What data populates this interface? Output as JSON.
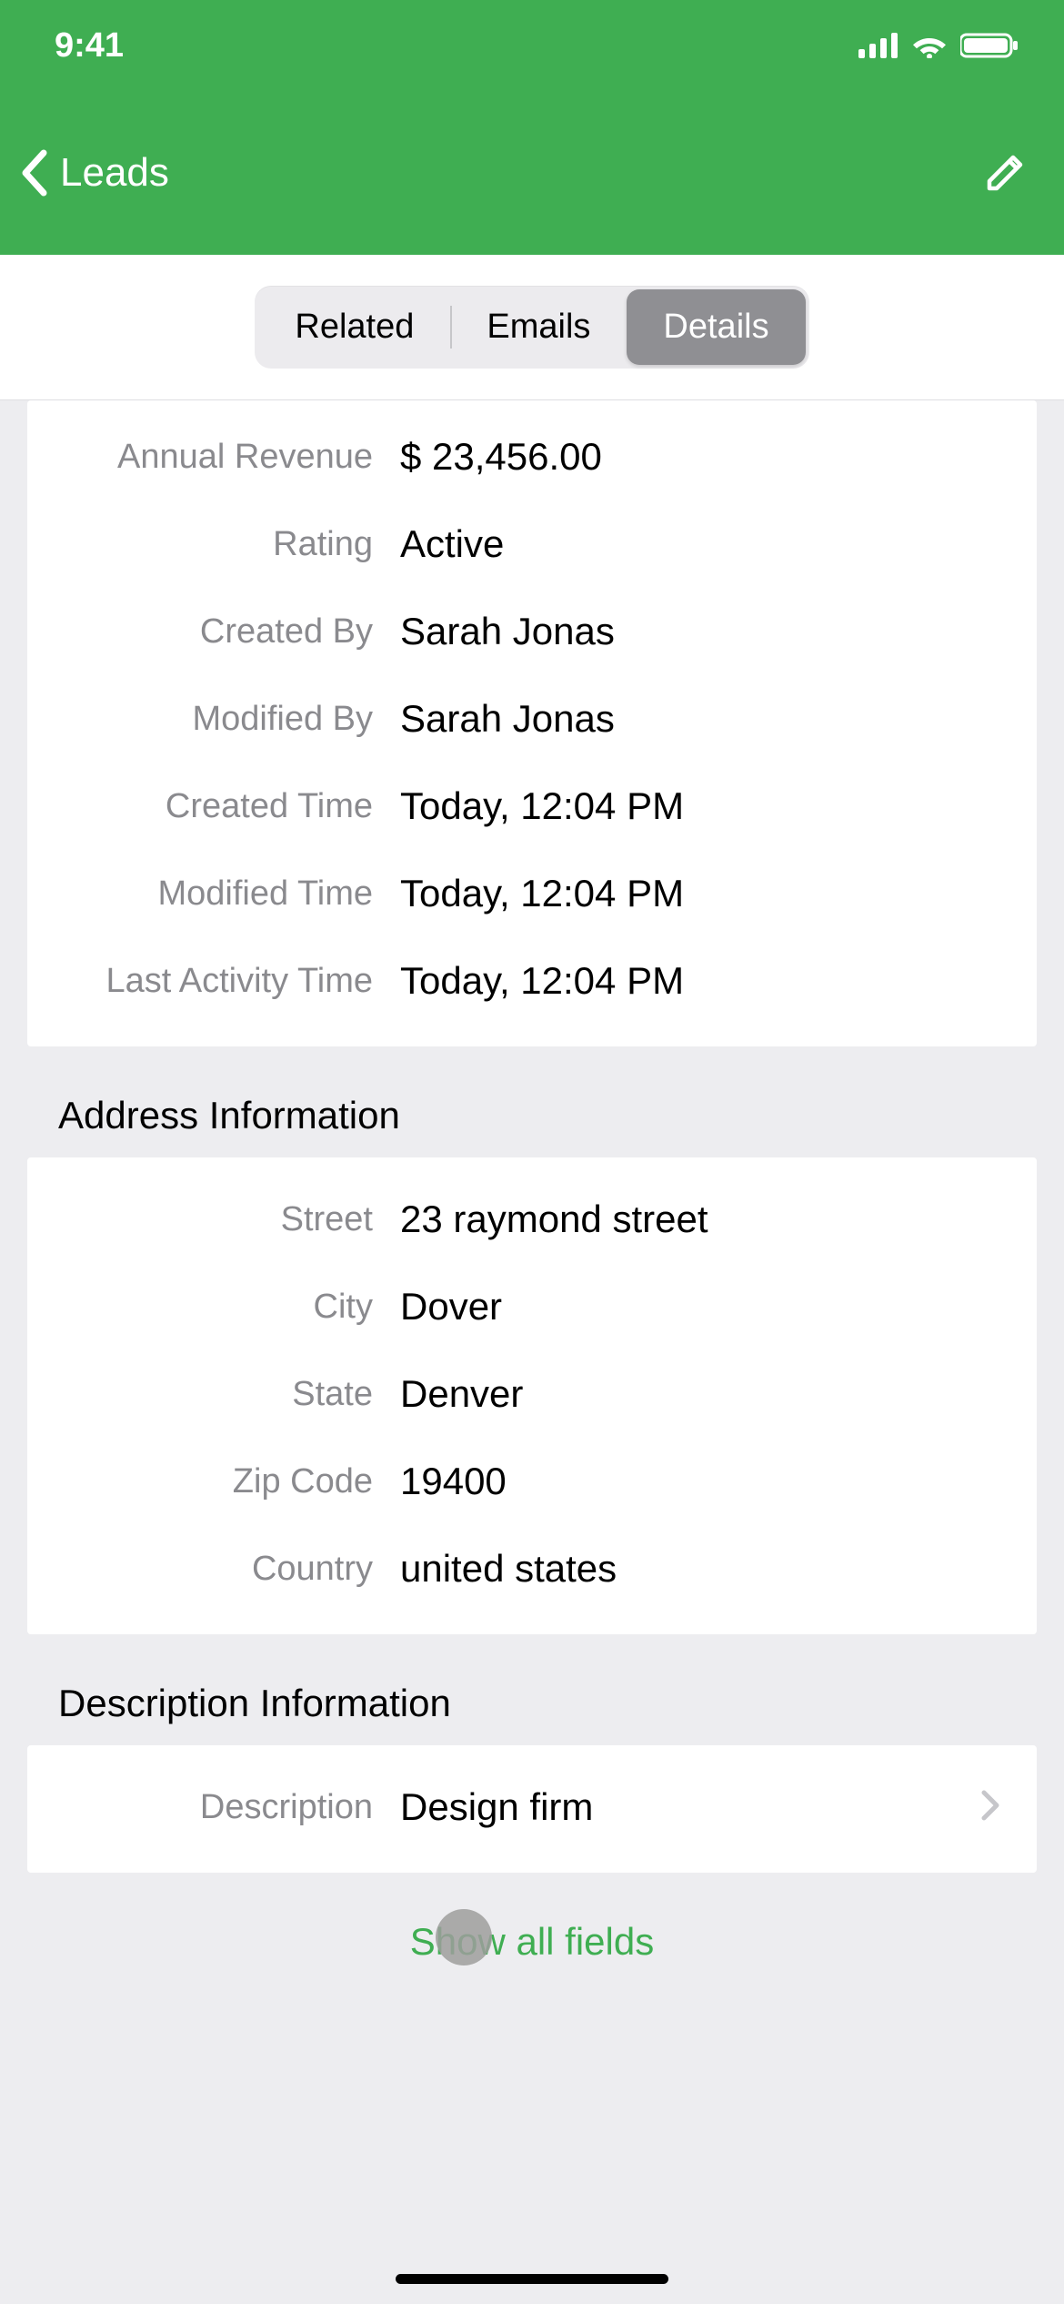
{
  "status": {
    "time": "9:41"
  },
  "nav": {
    "back_label": "Leads"
  },
  "tabs": {
    "related": "Related",
    "emails": "Emails",
    "details": "Details",
    "active": "details"
  },
  "general": {
    "fields": [
      {
        "label": "Annual Revenue",
        "value": "$ 23,456.00"
      },
      {
        "label": "Rating",
        "value": "Active"
      },
      {
        "label": "Created By",
        "value": "Sarah Jonas"
      },
      {
        "label": "Modified By",
        "value": "Sarah Jonas"
      },
      {
        "label": "Created Time",
        "value": "Today, 12:04 PM"
      },
      {
        "label": "Modified Time",
        "value": "Today, 12:04 PM"
      },
      {
        "label": "Last Activity Time",
        "value": "Today, 12:04 PM"
      }
    ]
  },
  "address_section": {
    "title": "Address Information",
    "fields": [
      {
        "label": "Street",
        "value": "23 raymond street"
      },
      {
        "label": "City",
        "value": "Dover"
      },
      {
        "label": "State",
        "value": "Denver"
      },
      {
        "label": "Zip Code",
        "value": "19400"
      },
      {
        "label": "Country",
        "value": "united states"
      }
    ]
  },
  "description_section": {
    "title": "Description Information",
    "field": {
      "label": "Description",
      "value": "Design firm"
    }
  },
  "show_all_label": "Show all fields"
}
